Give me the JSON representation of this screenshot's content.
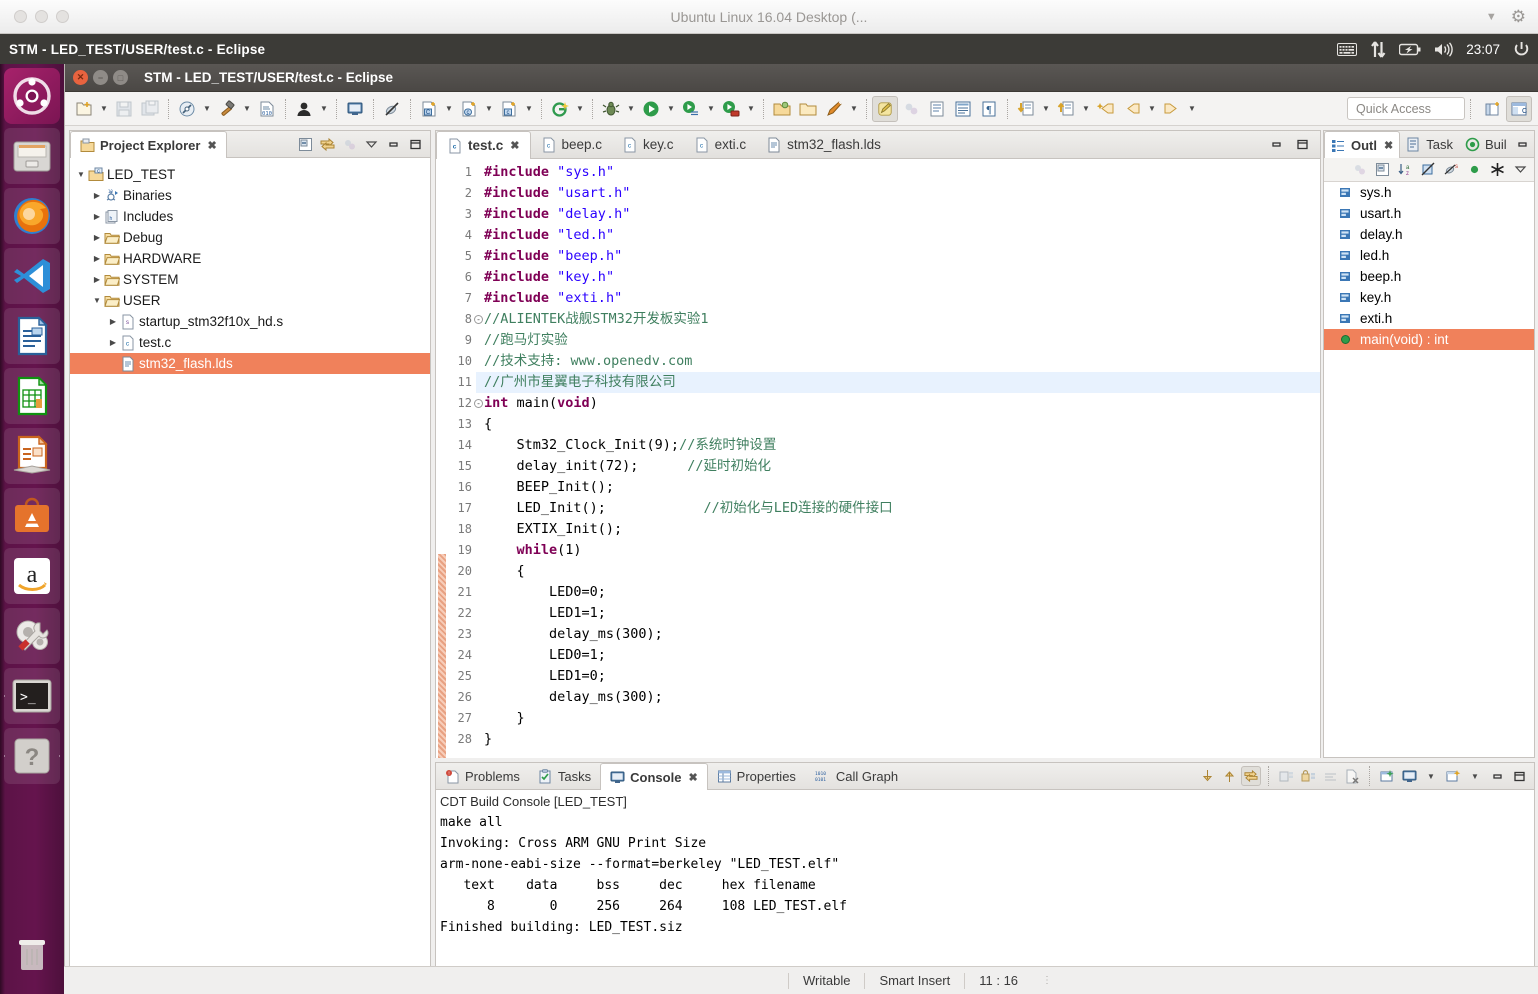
{
  "host_window": {
    "title": "Ubuntu Linux 16.04 Desktop (...",
    "caret_icon": "chevron-down-icon",
    "gear_icon": "gear-icon"
  },
  "unity_panel": {
    "app_title": "STM - LED_TEST/USER/test.c - Eclipse",
    "clock": "23:07",
    "tray_icons": [
      "keyboard-icon",
      "network-icon",
      "battery-icon",
      "volume-icon",
      "power-icon"
    ]
  },
  "launcher": {
    "items": [
      {
        "name": "ubuntu-dash",
        "label": "Ubuntu Dash",
        "running": false
      },
      {
        "name": "files",
        "label": "Files",
        "running": false
      },
      {
        "name": "firefox",
        "label": "Firefox",
        "running": false
      },
      {
        "name": "vscode",
        "label": "Visual Studio Code",
        "running": false
      },
      {
        "name": "libreoffice-writer",
        "label": "LibreOffice Writer",
        "running": false
      },
      {
        "name": "libreoffice-calc",
        "label": "LibreOffice Calc",
        "running": false
      },
      {
        "name": "libreoffice-impress",
        "label": "LibreOffice Impress",
        "running": false
      },
      {
        "name": "software-center",
        "label": "Ubuntu Software",
        "running": false
      },
      {
        "name": "amazon",
        "label": "Amazon",
        "running": false
      },
      {
        "name": "system-settings",
        "label": "System Settings",
        "running": false
      },
      {
        "name": "terminal",
        "label": "Terminal",
        "running": true
      },
      {
        "name": "help",
        "label": "Help",
        "running": true
      }
    ],
    "trash_label": "Trash"
  },
  "eclipse": {
    "window_title": "STM - LED_TEST/USER/test.c - Eclipse",
    "quick_access_placeholder": "Quick Access",
    "toolbar_items": [
      "new-file-icon",
      "save-icon",
      "save-all-icon",
      "build-all-icon",
      "build-hammer-icon",
      "binary-010-icon",
      "user-icon",
      "console-monitor-icon",
      "skip-breakpoints-icon",
      "new-c-project-icon",
      "new-c-class-icon",
      "new-c-source-icon",
      "new-g-project-icon",
      "debug-bug-icon",
      "run-icon",
      "run-history-icon",
      "run-external-icon",
      "open-folder-icon",
      "open-type-icon",
      "search-pencil-icon",
      "toggle-mark-icon",
      "toggle-block-icon",
      "show-whitespace-icon",
      "show-source-icon",
      "pilcrow-icon",
      "next-annotation-icon",
      "prev-annotation-icon",
      "last-edit-icon",
      "back-icon",
      "forward-icon"
    ],
    "perspective_icons": [
      "open-perspective-icon",
      "c-cpp-perspective-icon"
    ]
  },
  "project_explorer": {
    "tab_label": "Project Explorer",
    "tab_icon": "project-explorer-icon",
    "tools": [
      "collapse-all-icon",
      "link-with-editor-icon",
      "focus-icon",
      "view-menu-icon",
      "minimize-icon",
      "maximize-icon"
    ],
    "tree": [
      {
        "label": "LED_TEST",
        "depth": 0,
        "twisty": "▼",
        "icon": "c-project-icon",
        "selected": false
      },
      {
        "label": "Binaries",
        "depth": 1,
        "twisty": "▶",
        "icon": "binaries-icon",
        "selected": false
      },
      {
        "label": "Includes",
        "depth": 1,
        "twisty": "▶",
        "icon": "includes-icon",
        "selected": false
      },
      {
        "label": "Debug",
        "depth": 1,
        "twisty": "▶",
        "icon": "folder-icon",
        "selected": false
      },
      {
        "label": "HARDWARE",
        "depth": 1,
        "twisty": "▶",
        "icon": "folder-icon",
        "selected": false
      },
      {
        "label": "SYSTEM",
        "depth": 1,
        "twisty": "▶",
        "icon": "folder-icon",
        "selected": false
      },
      {
        "label": "USER",
        "depth": 1,
        "twisty": "▼",
        "icon": "folder-icon",
        "selected": false
      },
      {
        "label": "startup_stm32f10x_hd.s",
        "depth": 2,
        "twisty": "▶",
        "icon": "asm-file-icon",
        "selected": false
      },
      {
        "label": "test.c",
        "depth": 2,
        "twisty": "▶",
        "icon": "c-file-icon",
        "selected": false
      },
      {
        "label": "stm32_flash.lds",
        "depth": 2,
        "twisty": "",
        "icon": "lds-file-icon",
        "selected": true
      }
    ]
  },
  "editor": {
    "tabs": [
      {
        "label": "test.c",
        "icon": "c-file-icon",
        "active": true,
        "closable": true
      },
      {
        "label": "beep.c",
        "icon": "c-file-icon",
        "active": false,
        "closable": false
      },
      {
        "label": "key.c",
        "icon": "c-file-icon",
        "active": false,
        "closable": false
      },
      {
        "label": "exti.c",
        "icon": "c-file-icon",
        "active": false,
        "closable": false
      },
      {
        "label": "stm32_flash.lds",
        "icon": "lds-file-icon",
        "active": false,
        "closable": false
      }
    ],
    "tools": [
      "minimize-icon",
      "maximize-icon"
    ],
    "highlight_line": 11,
    "lines": [
      {
        "n": 1,
        "fold": "",
        "html": "<span class=\"pre\">#include</span> <span class=\"str\">\"sys.h\"</span>"
      },
      {
        "n": 2,
        "fold": "",
        "html": "<span class=\"pre\">#include</span> <span class=\"str\">\"usart.h\"</span>"
      },
      {
        "n": 3,
        "fold": "",
        "html": "<span class=\"pre\">#include</span> <span class=\"str\">\"delay.h\"</span>"
      },
      {
        "n": 4,
        "fold": "",
        "html": "<span class=\"pre\">#include</span> <span class=\"str\">\"led.h\"</span>"
      },
      {
        "n": 5,
        "fold": "",
        "html": "<span class=\"pre\">#include</span> <span class=\"str\">\"beep.h\"</span>"
      },
      {
        "n": 6,
        "fold": "",
        "html": "<span class=\"pre\">#include</span> <span class=\"str\">\"key.h\"</span>"
      },
      {
        "n": 7,
        "fold": "",
        "html": "<span class=\"pre\">#include</span> <span class=\"str\">\"exti.h\"</span>"
      },
      {
        "n": 8,
        "fold": "-",
        "html": "<span class=\"cmt\">//ALIENTEK战舰STM32开发板实验1</span>"
      },
      {
        "n": 9,
        "fold": "",
        "html": "<span class=\"cmt\">//跑马灯实验</span>"
      },
      {
        "n": 10,
        "fold": "",
        "html": "<span class=\"cmt\">//技术支持: www.openedv.com</span>"
      },
      {
        "n": 11,
        "fold": "",
        "html": "<span class=\"cmt\">//广州市星翼电子科技有限公司</span>"
      },
      {
        "n": 12,
        "fold": "-",
        "html": "<span class=\"kw\">int</span> main(<span class=\"kw\">void</span>)"
      },
      {
        "n": 13,
        "fold": "",
        "html": "{"
      },
      {
        "n": 14,
        "fold": "",
        "html": "    Stm32_Clock_Init(9);<span class=\"cmt\">//系统时钟设置</span>"
      },
      {
        "n": 15,
        "fold": "",
        "html": "    delay_init(72);      <span class=\"cmt\">//延时初始化</span>"
      },
      {
        "n": 16,
        "fold": "",
        "html": "    BEEP_Init();"
      },
      {
        "n": 17,
        "fold": "",
        "html": "    LED_Init();            <span class=\"cmt\">//初始化与LED连接的硬件接口</span>"
      },
      {
        "n": 18,
        "fold": "",
        "html": "    EXTIX_Init();"
      },
      {
        "n": 19,
        "fold": "",
        "html": "    <span class=\"kw\">while</span>(1)"
      },
      {
        "n": 20,
        "fold": "",
        "html": "    {"
      },
      {
        "n": 21,
        "fold": "",
        "html": "        LED0=0;"
      },
      {
        "n": 22,
        "fold": "",
        "html": "        LED1=1;"
      },
      {
        "n": 23,
        "fold": "",
        "html": "        delay_ms(300);"
      },
      {
        "n": 24,
        "fold": "",
        "html": "        LED0=1;"
      },
      {
        "n": 25,
        "fold": "",
        "html": "        LED1=0;"
      },
      {
        "n": 26,
        "fold": "",
        "html": "        delay_ms(300);"
      },
      {
        "n": 27,
        "fold": "",
        "html": "    }"
      },
      {
        "n": 28,
        "fold": "",
        "html": "}"
      }
    ]
  },
  "outline": {
    "tabs": [
      {
        "label": "Outl",
        "icon": "outline-icon",
        "active": true,
        "closable": true
      },
      {
        "label": "Task",
        "icon": "task-list-icon",
        "active": false,
        "closable": false
      },
      {
        "label": "Buil",
        "icon": "build-targets-icon",
        "active": false,
        "closable": false
      }
    ],
    "tools": [
      "minimize-icon",
      "maximize-icon"
    ],
    "toolbar": [
      "focus-icon",
      "collapse-all-icon",
      "sort-az-icon",
      "hide-fields-icon",
      "hide-static-icon",
      "hide-nonpublic-icon",
      "hide-macros-icon",
      "view-menu-icon"
    ],
    "items": [
      {
        "label": "sys.h",
        "icon": "include-icon",
        "selected": false
      },
      {
        "label": "usart.h",
        "icon": "include-icon",
        "selected": false
      },
      {
        "label": "delay.h",
        "icon": "include-icon",
        "selected": false
      },
      {
        "label": "led.h",
        "icon": "include-icon",
        "selected": false
      },
      {
        "label": "beep.h",
        "icon": "include-icon",
        "selected": false
      },
      {
        "label": "key.h",
        "icon": "include-icon",
        "selected": false
      },
      {
        "label": "exti.h",
        "icon": "include-icon",
        "selected": false
      },
      {
        "label": "main(void) : int",
        "icon": "function-icon",
        "selected": true
      }
    ]
  },
  "console": {
    "tabs": [
      {
        "label": "Problems",
        "icon": "problems-icon",
        "active": false,
        "closable": false
      },
      {
        "label": "Tasks",
        "icon": "tasks-icon",
        "active": false,
        "closable": false
      },
      {
        "label": "Console",
        "icon": "console-icon",
        "active": true,
        "closable": true
      },
      {
        "label": "Properties",
        "icon": "properties-icon",
        "active": false,
        "closable": false
      },
      {
        "label": "Call Graph",
        "icon": "call-graph-icon",
        "active": false,
        "closable": false
      }
    ],
    "tools": [
      "scroll-down-icon",
      "scroll-up-icon",
      "scroll-lock-icon",
      "clear-console-icon",
      "lock-scroll-icon",
      "word-wrap-icon",
      "remove-console-icon",
      "pin-console-icon",
      "display-console-icon",
      "open-console-icon",
      "minimize-icon",
      "maximize-icon"
    ],
    "subtitle": "CDT Build Console [LED_TEST]",
    "output": [
      "make all",
      "Invoking: Cross ARM GNU Print Size",
      "arm-none-eabi-size --format=berkeley \"LED_TEST.elf\"",
      "   text    data     bss     dec     hex filename",
      "      8       0     256     264     108 LED_TEST.elf",
      "Finished building: LED_TEST.siz"
    ]
  },
  "statusbar": {
    "writable": "Writable",
    "insert_mode": "Smart Insert",
    "cursor_position": "11 : 16"
  },
  "colors": {
    "selection": "#f0815b",
    "launcher_bg": "#65144d",
    "panel_bg": "#3c3b37",
    "keyword": "#7f0055",
    "string": "#2a00ff",
    "comment": "#3f7f5f"
  }
}
